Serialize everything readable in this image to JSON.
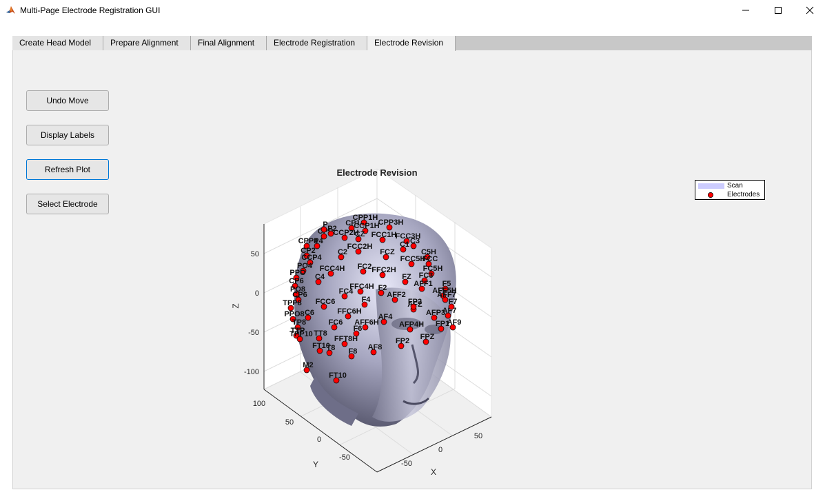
{
  "window": {
    "title": "Multi-Page Electrode Registration GUI",
    "controls": [
      "minimize",
      "maximize",
      "close"
    ]
  },
  "tabs": [
    {
      "label": "Create Head Model",
      "active": false
    },
    {
      "label": "Prepare Alignment",
      "active": false
    },
    {
      "label": "Final Alignment",
      "active": false
    },
    {
      "label": "Electrode Registration",
      "active": false
    },
    {
      "label": "Electrode Revision",
      "active": true
    }
  ],
  "buttons": {
    "undo_move": "Undo Move",
    "display_labels": "Display Labels",
    "refresh_plot": "Refresh Plot",
    "select_electrode": "Select Electrode"
  },
  "plot": {
    "title": "Electrode Revision",
    "z_axis_label": "Z",
    "y_axis_label": "Y",
    "x_axis_label": "X",
    "z_ticks": [
      "50",
      "0",
      "-50",
      "-100"
    ],
    "y_ticks": [
      "100",
      "50",
      "0",
      "-50"
    ],
    "x_ticks": [
      "-50",
      "0",
      "50"
    ],
    "legend": [
      {
        "label": "Scan",
        "color": "#ccccff"
      },
      {
        "label": "Electrodes",
        "color": "#ff0000"
      }
    ],
    "electrode_labels": [
      {
        "t": "CPP1H"
      },
      {
        "t": "CPP3H"
      },
      {
        "t": "CP1"
      },
      {
        "t": "CCP1H"
      },
      {
        "t": "CPP"
      },
      {
        "t": "P"
      },
      {
        "t": "P2"
      },
      {
        "t": "CCP2H"
      },
      {
        "t": "CZ"
      },
      {
        "t": "FCC1H"
      },
      {
        "t": "FCC3H"
      },
      {
        "t": "C3"
      },
      {
        "t": "C1"
      },
      {
        "t": "CPP4"
      },
      {
        "t": "P4"
      },
      {
        "t": "CP2"
      },
      {
        "t": "FCC2H"
      },
      {
        "t": "FCZ"
      },
      {
        "t": "C5H"
      },
      {
        "t": "FCC5H"
      },
      {
        "t": "FCC"
      },
      {
        "t": "C2"
      },
      {
        "t": "CCP4"
      },
      {
        "t": "PO4"
      },
      {
        "t": "FCC4H"
      },
      {
        "t": "FC2"
      },
      {
        "t": "FFC2H"
      },
      {
        "t": "FC5H"
      },
      {
        "t": "PPO"
      },
      {
        "t": "C4"
      },
      {
        "t": "FZ"
      },
      {
        "t": "FC3"
      },
      {
        "t": "CP6"
      },
      {
        "t": "FFC4H"
      },
      {
        "t": "F2"
      },
      {
        "t": "AFF1"
      },
      {
        "t": "F5"
      },
      {
        "t": "PO8"
      },
      {
        "t": "CP6"
      },
      {
        "t": "FC4"
      },
      {
        "t": "AFF2"
      },
      {
        "t": "AFF5H"
      },
      {
        "t": "TPP8"
      },
      {
        "t": "FCC6"
      },
      {
        "t": "F4"
      },
      {
        "t": "AFZ"
      },
      {
        "t": "AFF7"
      },
      {
        "t": "PPO8"
      },
      {
        "t": "C6"
      },
      {
        "t": "FFC6H"
      },
      {
        "t": "AFP3"
      },
      {
        "t": "AF7"
      },
      {
        "t": "TP8"
      },
      {
        "t": "FC6"
      },
      {
        "t": "AF4"
      },
      {
        "t": "AFF6H"
      },
      {
        "t": "AFP4H"
      },
      {
        "t": "FP1"
      },
      {
        "t": "TTP"
      },
      {
        "t": "TT8"
      },
      {
        "t": "F6"
      },
      {
        "t": "AF9"
      },
      {
        "t": "TPP10"
      },
      {
        "t": "FFT8H"
      },
      {
        "t": "FPZ"
      },
      {
        "t": "FP2"
      },
      {
        "t": "FT10"
      },
      {
        "t": "T8"
      },
      {
        "t": "AF8"
      },
      {
        "t": "F8"
      },
      {
        "t": "M2"
      },
      {
        "t": "FT10"
      },
      {
        "t": "F7"
      },
      {
        "t": "FP2"
      }
    ]
  }
}
